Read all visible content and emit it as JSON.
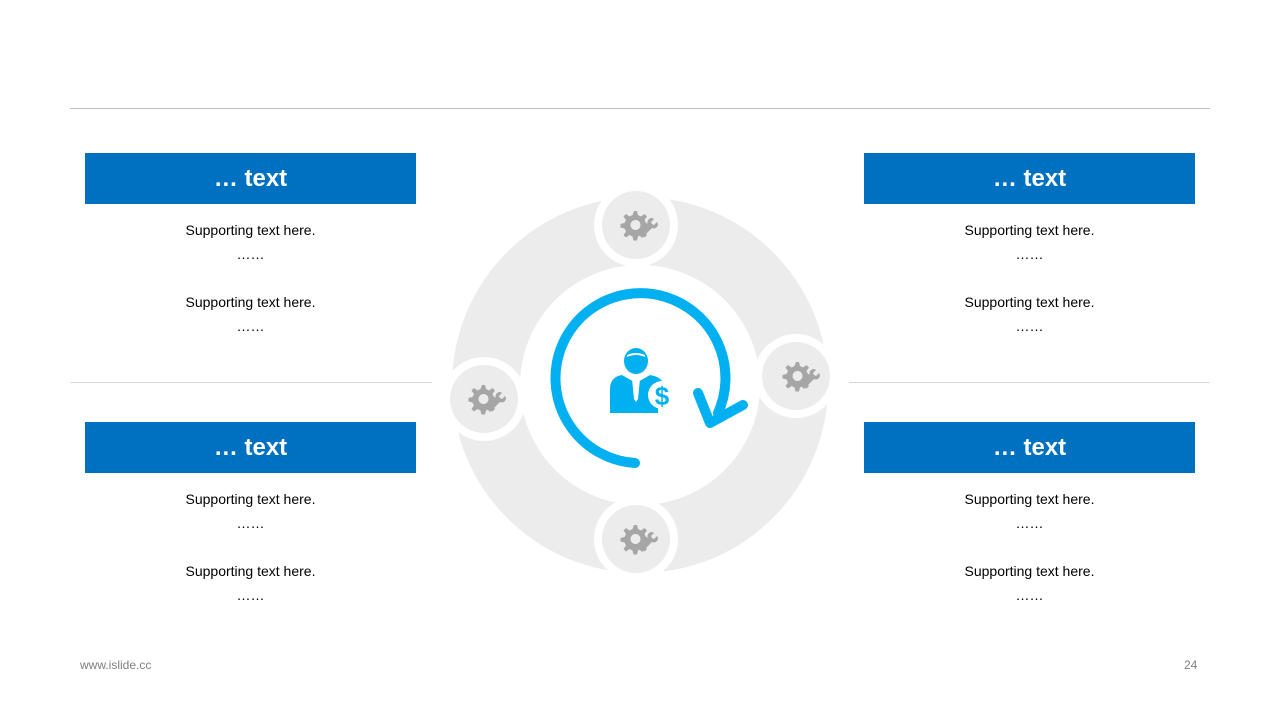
{
  "boxes": [
    {
      "title": "… text",
      "lines": [
        "Supporting  text here.",
        "……",
        "Supporting  text here.",
        "……"
      ]
    },
    {
      "title": "… text",
      "lines": [
        "Supporting  text here.",
        "……",
        "Supporting  text here.",
        "……"
      ]
    },
    {
      "title": "… text",
      "lines": [
        "Supporting  text here.",
        "……",
        "Supporting  text here.",
        "……"
      ]
    },
    {
      "title": "… text",
      "lines": [
        "Supporting  text here.",
        "……",
        "Supporting  text here.",
        "……"
      ]
    }
  ],
  "footer": {
    "website": "www.islide.cc",
    "page_number": "24"
  },
  "diagram": {
    "center_icon": "businessman-dollar-icon",
    "arrow_icon": "circular-arrow-icon",
    "node_icon": "gear-wrench-icon",
    "accent_color": "#00b0f0",
    "ring_color": "#eeeeee",
    "node_icon_color": "#a6a6a6"
  },
  "colors": {
    "header_blue": "#0070c0",
    "rule_gray": "#bfbfbf"
  }
}
